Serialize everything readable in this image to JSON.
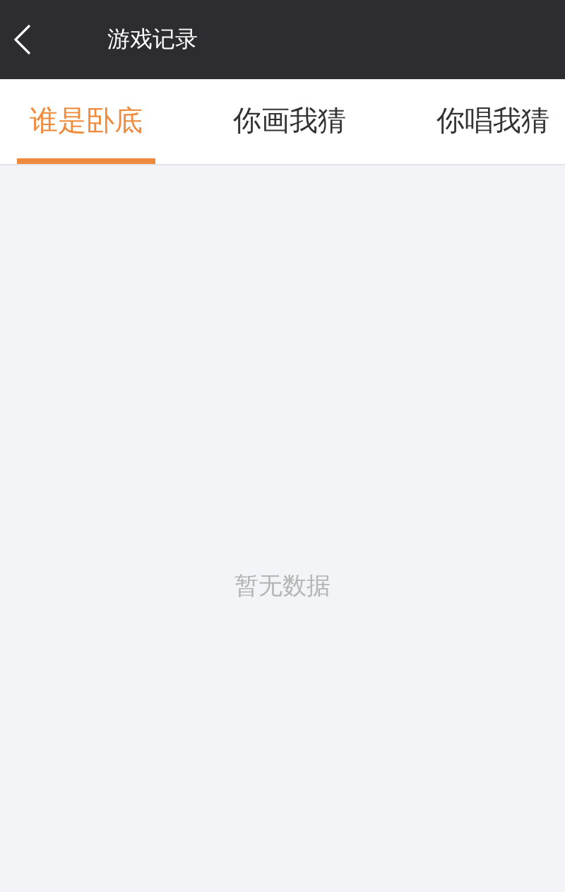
{
  "header": {
    "title": "游戏记录"
  },
  "tabs": [
    {
      "label": "谁是卧底",
      "selected": true
    },
    {
      "label": "你画我猜",
      "selected": false
    },
    {
      "label": "你唱我猜",
      "selected": false
    }
  ],
  "empty_message": "暂无数据"
}
